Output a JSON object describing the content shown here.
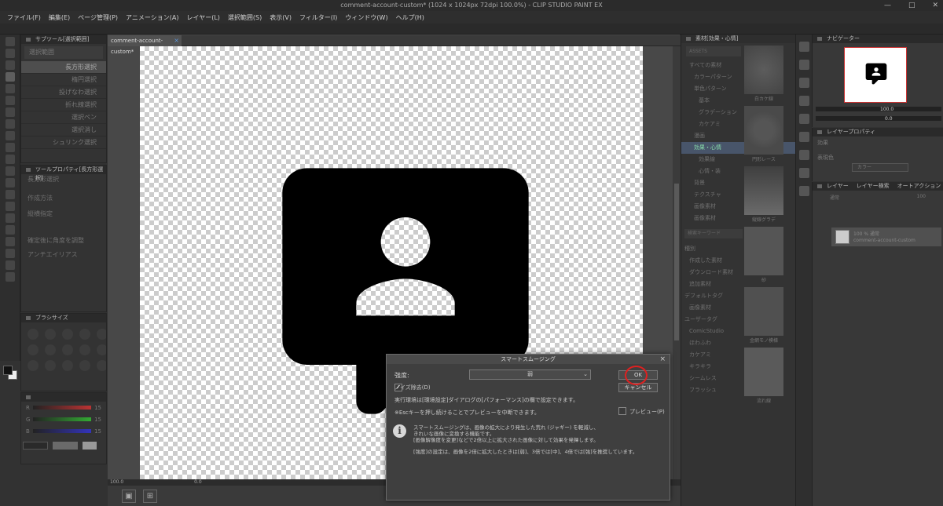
{
  "window": {
    "title": "comment-account-custom* (1024 x 1024px 72dpi 100.0%)  - CLIP STUDIO PAINT EX",
    "controls": [
      "—",
      "□",
      "✕"
    ]
  },
  "menu": [
    "ファイル(F)",
    "編集(E)",
    "ページ管理(P)",
    "アニメーション(A)",
    "レイヤー(L)",
    "選択範囲(S)",
    "表示(V)",
    "フィルター(I)",
    "ウィンドウ(W)",
    "ヘルプ(H)"
  ],
  "subtool_panel": {
    "title": "サブツール[選択範囲]",
    "group": "選択範囲",
    "items": [
      "長方形選択",
      "楕円選択",
      "投げなわ選択",
      "折れ線選択",
      "選択ペン",
      "選択消し",
      "シュリンク選択"
    ],
    "selected_index": 0
  },
  "toolprop_panel": {
    "title": "ツールプロパティ[長方形選択]",
    "tool_name": "長方形選択",
    "rows": [
      "作成方法",
      "縦横指定",
      "確定後に角度を調整",
      "アンチエイリアス"
    ]
  },
  "brushsize_panel": {
    "title": "ブラシサイズ"
  },
  "color_slider": {
    "channels": [
      "R",
      "G",
      "B"
    ],
    "values": [
      "15",
      "15",
      "15"
    ]
  },
  "document": {
    "tab": "comment-account-custom*",
    "zoom": "100.0",
    "angle": "0.0"
  },
  "material_panel": {
    "title": "素材[効果・心情]",
    "search_placeholder": "ASSETS",
    "tree": [
      "すべての素材",
      "カラーパターン",
      "単色パターン",
      "基本",
      "グラデーション",
      "カケアミ",
      "漫画",
      "効果・心情",
      "効果線",
      "心情・装",
      "背景",
      "テクスチャ",
      "画像素材",
      "画像素材"
    ],
    "selected_index": 7,
    "search_input": "検索キーワード",
    "tags_title": "種別",
    "tags": [
      "作成した素材",
      "ダウンロード素材",
      "追加素材",
      "デフォルトタグ",
      "画像素材",
      "ユーザータグ",
      "ComicStudio",
      "ほわふわ",
      "カケアミ",
      "キラキラ",
      "シームレス",
      "フラッシュ"
    ],
    "thumbs": [
      "白カケ線",
      "円形レース",
      "縦線グラデ",
      "砂",
      "金網モノ模様",
      "流れ線"
    ]
  },
  "navigator": {
    "title": "ナビゲーター",
    "zoom": "100.0",
    "angle": "0.0"
  },
  "layer_property": {
    "title": "レイヤープロパティ",
    "effect_label": "効果",
    "expression_label": "表現色",
    "expression_value": "カラー"
  },
  "layers": {
    "tabs": [
      "レイヤー",
      "レイヤー検索",
      "オートアクション"
    ],
    "blend": "通常",
    "opacity": "100",
    "row": {
      "mode": "100 % 通常",
      "name": "comment-account-custom"
    }
  },
  "dialog": {
    "title": "スマートスムージング",
    "strength_label": "強度:",
    "strength_value": "弱",
    "noise_label": "ノイズ除去(D)",
    "noise_checked": true,
    "line1": "実行環境は[環境設定]ダイアログの[パフォーマンス]の欄で設定できます。",
    "line2": "※Escキーを押し続けることでプレビューを中断できます。",
    "ok": "OK",
    "cancel": "キャンセル",
    "preview_label": "プレビュー(P)",
    "preview_checked": false,
    "info": [
      "スマートスムージングは、画像の拡大により発生した荒れ (ジャギー) を軽減し、",
      "きれいな画像に変換する機能です。",
      "[画像解像度を変更]などで2倍以上に拡大された画像に対して効果を発揮します。",
      "[強度]の設定は、画像を2倍に拡大したときは[弱]、3倍では[中]、4倍では[強]を推奨しています。"
    ]
  },
  "colors": {
    "ok_highlight": "#e02020",
    "canvas_icon": "#000000",
    "selection_blue": "#48556a"
  },
  "icons": [
    "comment-account-icon",
    "info-icon",
    "close-icon",
    "check-icon",
    "chevron-down-icon"
  ]
}
